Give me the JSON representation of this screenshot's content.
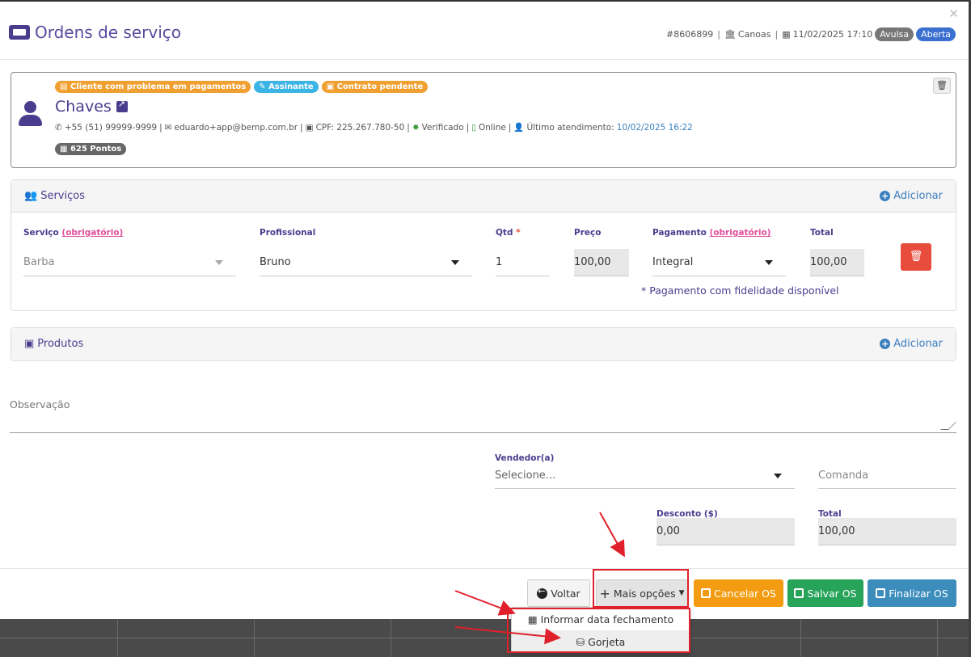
{
  "header": {
    "title": "Ordens de serviço",
    "order_id": "#8606899",
    "location": "Canoas",
    "datetime": "11/02/2025 17:10",
    "badge_type": "Avulsa",
    "badge_status": "Aberta"
  },
  "client": {
    "tags": [
      "Cliente com problema em pagamentos",
      "Assinante",
      "Contrato pendente"
    ],
    "name": "Chaves",
    "phone": "+55 (51) 99999-9999",
    "email": "eduardo+app@bemp.com.br",
    "cpf": "CPF: 225.267.780-50",
    "verified": "Verificado",
    "online": "Online",
    "last_visit_label": "Último atendimento:",
    "last_visit_value": "10/02/2025 16:22",
    "points": "625 Pontos"
  },
  "services": {
    "title": "Serviços",
    "add_label": "Adicionar",
    "labels": {
      "service": "Serviço",
      "required": "(obrigatório)",
      "professional": "Profissional",
      "qty": "Qtd",
      "qty_req": "*",
      "price": "Preço",
      "payment": "Pagamento",
      "total": "Total"
    },
    "row": {
      "service": "Barba",
      "professional": "Bruno",
      "qty": "1",
      "price": "100,00",
      "payment": "Integral",
      "total": "100,00"
    },
    "note": "* Pagamento com fidelidade disponível"
  },
  "products": {
    "title": "Produtos",
    "add_label": "Adicionar"
  },
  "observation_label": "Observação",
  "seller": {
    "label": "Vendedor(a)",
    "placeholder": "Selecione...",
    "comanda_placeholder": "Comanda"
  },
  "summary": {
    "discount_label": "Desconto ($)",
    "discount_value": "0,00",
    "total_label": "Total",
    "total_value": "100,00"
  },
  "buttons": {
    "back": "Voltar",
    "more": "Mais opções",
    "cancel": "Cancelar OS",
    "save": "Salvar OS",
    "finalize": "Finalizar OS"
  },
  "more_menu": {
    "items": [
      "Informar data fechamento",
      "Gorjeta"
    ]
  },
  "colors": {
    "brand": "#4a3d8e",
    "link": "#3b7fbf",
    "orange": "#f39c12",
    "green": "#27a35a",
    "blue": "#3c8dbc",
    "red": "#e74c3c",
    "annotation": "#e0202a"
  }
}
